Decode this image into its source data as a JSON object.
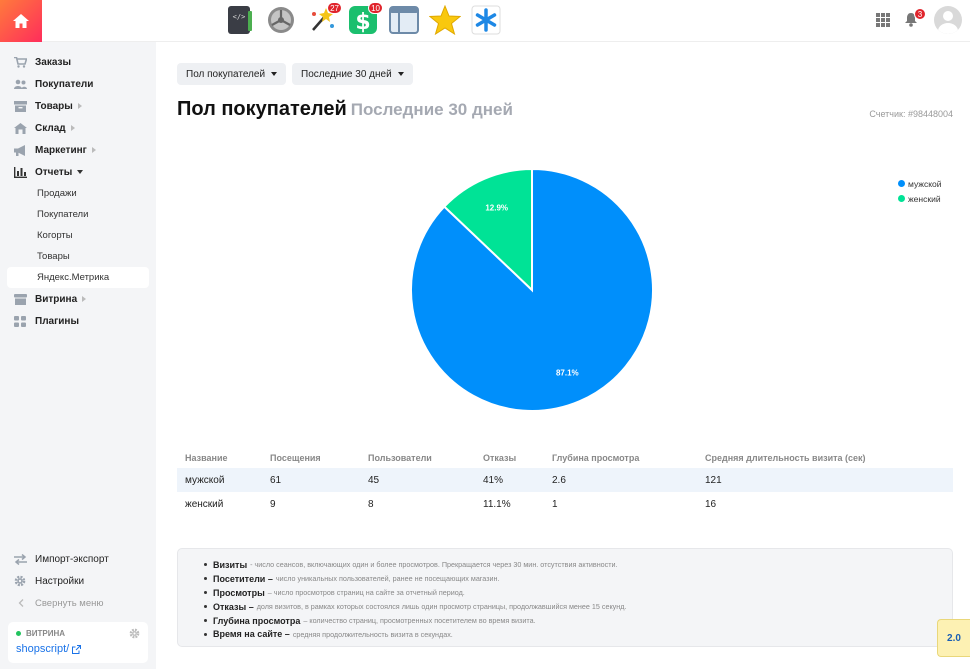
{
  "topbar": {
    "apps": [
      {
        "icon": "code-editor-icon",
        "badge": ""
      },
      {
        "icon": "settings-wheel-icon",
        "badge": ""
      },
      {
        "icon": "magic-wand-icon",
        "badge": "27"
      },
      {
        "icon": "shop-dollar-icon",
        "badge": "10"
      },
      {
        "icon": "window-layout-icon",
        "badge": ""
      },
      {
        "icon": "star-icon",
        "badge": ""
      },
      {
        "icon": "asterisk-icon",
        "badge": ""
      }
    ],
    "notifications_badge": "3"
  },
  "sidebar": {
    "items": [
      {
        "label": "Заказы"
      },
      {
        "label": "Покупатели"
      },
      {
        "label": "Товары"
      },
      {
        "label": "Склад"
      },
      {
        "label": "Маркетинг"
      },
      {
        "label": "Отчеты"
      }
    ],
    "reports_sub": [
      {
        "label": "Продажи"
      },
      {
        "label": "Покупатели"
      },
      {
        "label": "Когорты"
      },
      {
        "label": "Товары"
      },
      {
        "label": "Яндекс.Метрика"
      }
    ],
    "after": [
      {
        "label": "Витрина"
      },
      {
        "label": "Плагины"
      }
    ],
    "bottom": {
      "import_export": "Импорт-экспорт",
      "settings": "Настройки",
      "collapse": "Свернуть меню"
    },
    "storefront": {
      "label": "ВИТРИНА",
      "link": "shopscript/"
    }
  },
  "filters": {
    "metric": "Пол покупателей",
    "period": "Последние 30 дней"
  },
  "header": {
    "title": "Пол покупателей",
    "subtitle": "Последние 30 дней",
    "counter": "Счетчик: #98448004"
  },
  "chart_data": {
    "type": "pie",
    "slices": [
      {
        "label": "мужской",
        "value": 87.1,
        "display": "87.1%",
        "color": "#008ffb"
      },
      {
        "label": "женский",
        "value": 12.9,
        "display": "12.9%",
        "color": "#00e396"
      }
    ],
    "legend_position": "top-right"
  },
  "table": {
    "columns": [
      "Название",
      "Посещения",
      "Пользователи",
      "Отказы",
      "Глубина просмотра",
      "Средняя длительность визита (сек)"
    ],
    "rows": [
      [
        "мужской",
        "61",
        "45",
        "41%",
        "2.6",
        "121"
      ],
      [
        "женский",
        "9",
        "8",
        "11.1%",
        "1",
        "16"
      ]
    ]
  },
  "info": [
    {
      "term": "Визиты",
      "text": "- число сеансов, включающих один и более просмотров. Прекращается через 30 мин. отсутствия активности."
    },
    {
      "term": "Посетители –",
      "text": "число уникальных пользователей, ранее не посещающих магазин."
    },
    {
      "term": "Просмотры",
      "text": "– число просмотров страниц на сайте за отчетный период."
    },
    {
      "term": "Отказы –",
      "text": "доля визитов, в рамках которых состоялся лишь один просмотр страницы, продолжавшийся менее 15 секунд."
    },
    {
      "term": "Глубина просмотра",
      "text": "– количество страниц, просмотренных посетителем во время визита."
    },
    {
      "term": "Время на сайте –",
      "text": "средняя продолжительность визита в секундах."
    }
  ],
  "version": "2.0"
}
